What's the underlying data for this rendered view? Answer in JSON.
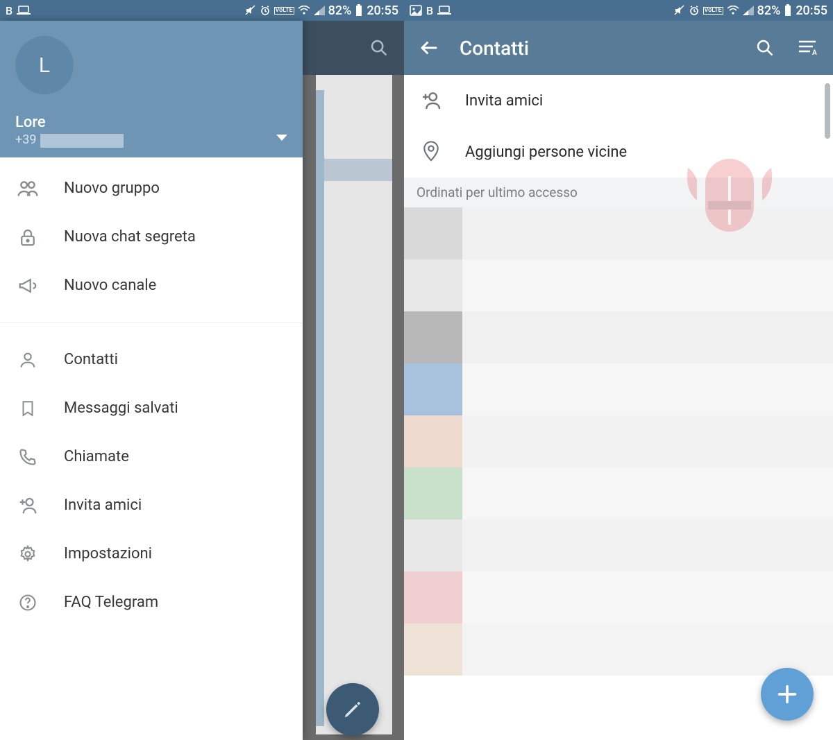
{
  "status_bar": {
    "indicators_left": [
      "B",
      "⌂"
    ],
    "indicators_left_right": [
      "▧",
      "B",
      "⌂"
    ],
    "battery_text": "82%",
    "time": "20:55",
    "volte": "VoLTE"
  },
  "left_screen": {
    "avatar_initial": "L",
    "username": "Lore",
    "phone_prefix": "+39",
    "menu_group1": [
      {
        "icon": "group-icon",
        "label": "Nuovo gruppo"
      },
      {
        "icon": "lock-icon",
        "label": "Nuova chat segreta"
      },
      {
        "icon": "megaphone-icon",
        "label": "Nuovo canale"
      }
    ],
    "menu_group2": [
      {
        "icon": "person-icon",
        "label": "Contatti"
      },
      {
        "icon": "bookmark-icon",
        "label": "Messaggi salvati"
      },
      {
        "icon": "phone-icon",
        "label": "Chiamate"
      },
      {
        "icon": "add-person-icon",
        "label": "Invita amici"
      },
      {
        "icon": "gear-icon",
        "label": "Impostazioni"
      },
      {
        "icon": "help-icon",
        "label": "FAQ Telegram"
      }
    ]
  },
  "right_screen": {
    "title": "Contatti",
    "options": [
      {
        "icon": "add-person-icon",
        "label": "Invita amici"
      },
      {
        "icon": "location-icon",
        "label": "Aggiungi persone vicine"
      }
    ],
    "section_header": "Ordinati per ultimo accesso",
    "blur_rows": [
      {
        "av": "#d9d9d9",
        "txt": "#f1f1f1"
      },
      {
        "av": "#e7e7e7",
        "txt": "#f6f6f6"
      },
      {
        "av": "#b7b7b7",
        "txt": "#f0f0f0"
      },
      {
        "av": "#a8c1dd",
        "txt": "#f6f6f6"
      },
      {
        "av": "#eed9cf",
        "txt": "#f2f2f2"
      },
      {
        "av": "#c9e0cb",
        "txt": "#f6f6f6"
      },
      {
        "av": "#e8e8e8",
        "txt": "#f2f2f2"
      },
      {
        "av": "#f0cfd2",
        "txt": "#f6f6f6"
      },
      {
        "av": "#efe2d6",
        "txt": "#f3f3f3"
      }
    ]
  }
}
